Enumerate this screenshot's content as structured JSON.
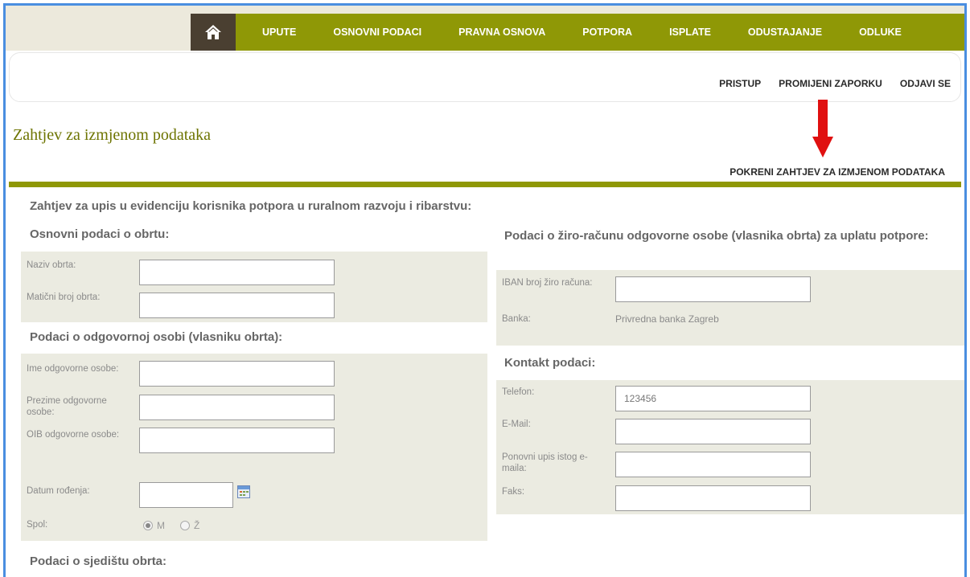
{
  "nav": {
    "items": [
      "UPUTE",
      "OSNOVNI PODACI",
      "PRAVNA OSNOVA",
      "POTPORA",
      "ISPLATE",
      "ODUSTAJANJE",
      "ODLUKE"
    ],
    "home_icon": "home-icon"
  },
  "subnav": {
    "pristup": "PRISTUP",
    "change_password": "PROMIJENI ZAPORKU",
    "logout": "ODJAVI SE"
  },
  "page": {
    "title": "Zahtjev za izmjenom podataka",
    "start_request": "POKRENI ZAHTJEV ZA IZMJENOM PODATAKA",
    "form_title": "Zahtjev za upis u evidenciju korisnika potpora u ruralnom razvoju i ribarstvu:"
  },
  "left": {
    "basic_title": "Osnovni podaci o obrtu:",
    "naziv_label": "Naziv obrta:",
    "maticni_label": "Matični broj obrta:",
    "person_title": "Podaci o odgovornoj osobi (vlasniku obrta):",
    "ime_label": "Ime odgovorne osobe:",
    "prezime_label": "Prezime odgovorne osobe:",
    "oib_label": "OIB odgovorne osobe:",
    "datum_label": "Datum rođenja:",
    "spol_label": "Spol:",
    "spol_m": "M",
    "spol_z": "Ž",
    "seat_title": "Podaci o sjedištu obrta:"
  },
  "right": {
    "bank_title": "Podaci o žiro-računu odgovorne osobe (vlasnika obrta) za uplatu potpore:",
    "iban_label": "IBAN broj žiro računa:",
    "banka_label": "Banka:",
    "banka_value": "Privredna banka Zagreb",
    "contact_title": "Kontakt podaci:",
    "telefon_label": "Telefon:",
    "telefon_value": "123456",
    "email_label": "E-Mail:",
    "email2_label": "Ponovni upis istog e-maila:",
    "faks_label": "Faks:"
  },
  "colors": {
    "olive": "#8f9806",
    "dark_brown": "#4a3f31",
    "panel": "#ebebe1",
    "title": "#6d7400",
    "arrow": "#e01010"
  }
}
